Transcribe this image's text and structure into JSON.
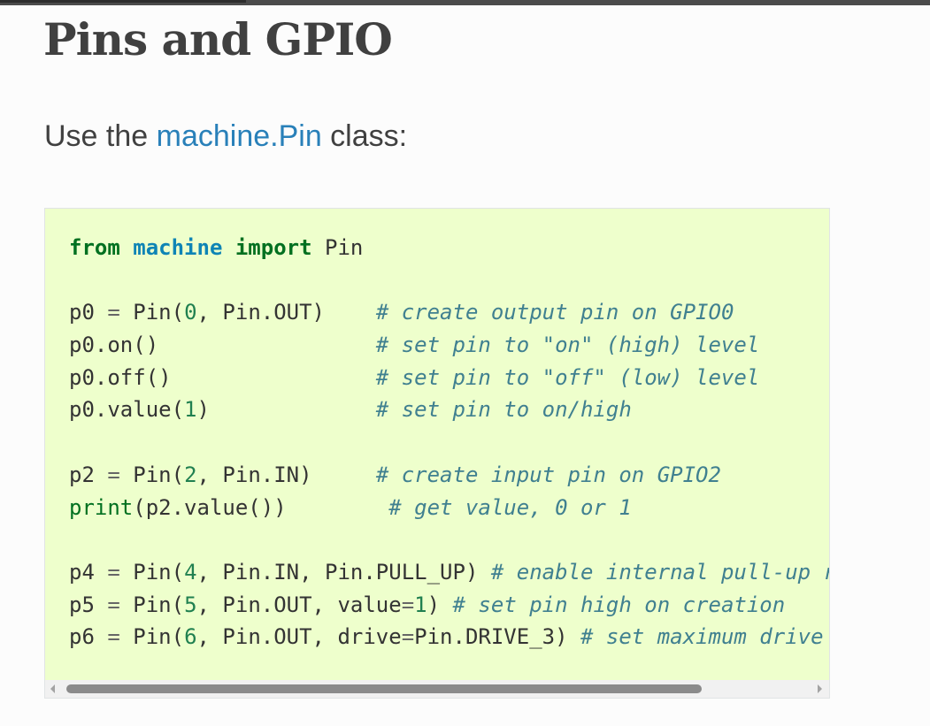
{
  "page": {
    "title": "Pins and GPIO",
    "intro_prefix": "Use the ",
    "intro_link": "machine.Pin",
    "intro_suffix": " class:"
  },
  "code": {
    "l1": {
      "kw1": "from",
      "mod": "machine",
      "kw2": "import",
      "name": "Pin"
    },
    "l3": {
      "code1": "p0 ",
      "eq": "=",
      "code2": " Pin(",
      "num": "0",
      "code3": ", Pin.OUT)    ",
      "comment": "# create output pin on GPIO0"
    },
    "l4": {
      "code": "p0.on()                 ",
      "comment": "# set pin to \"on\" (high) level"
    },
    "l5": {
      "code": "p0.off()                ",
      "comment": "# set pin to \"off\" (low) level"
    },
    "l6": {
      "code1": "p0.value(",
      "num": "1",
      "code2": ")             ",
      "comment": "# set pin to on/high"
    },
    "l8": {
      "code1": "p2 ",
      "eq": "=",
      "code2": " Pin(",
      "num": "2",
      "code3": ", Pin.IN)     ",
      "comment": "# create input pin on GPIO2"
    },
    "l9": {
      "builtin": "print",
      "code": "(p2.value())        ",
      "comment": "# get value, 0 or 1"
    },
    "l11": {
      "code1": "p4 ",
      "eq": "=",
      "code2": " Pin(",
      "num": "4",
      "code3": ", Pin.IN, Pin.PULL_UP) ",
      "comment": "# enable internal pull-up r"
    },
    "l12": {
      "code1": "p5 ",
      "eq": "=",
      "code2": " Pin(",
      "num": "5",
      "code3": ", Pin.OUT, value",
      "eq2": "=",
      "num2": "1",
      "code4": ") ",
      "comment": "# set pin high on creation"
    },
    "l13": {
      "code1": "p6 ",
      "eq": "=",
      "code2": " Pin(",
      "num": "6",
      "code3": ", Pin.OUT, drive",
      "eq2": "=",
      "code4": "Pin.DRIVE_3) ",
      "comment": "# set maximum drive"
    }
  },
  "colors": {
    "code_background": "#eeffcc",
    "link": "#2980b9",
    "keyword": "#007020",
    "namespace": "#0e84b5",
    "number": "#208050",
    "comment": "#408090"
  },
  "scrollbar": {
    "thumb_fraction": 0.81
  }
}
